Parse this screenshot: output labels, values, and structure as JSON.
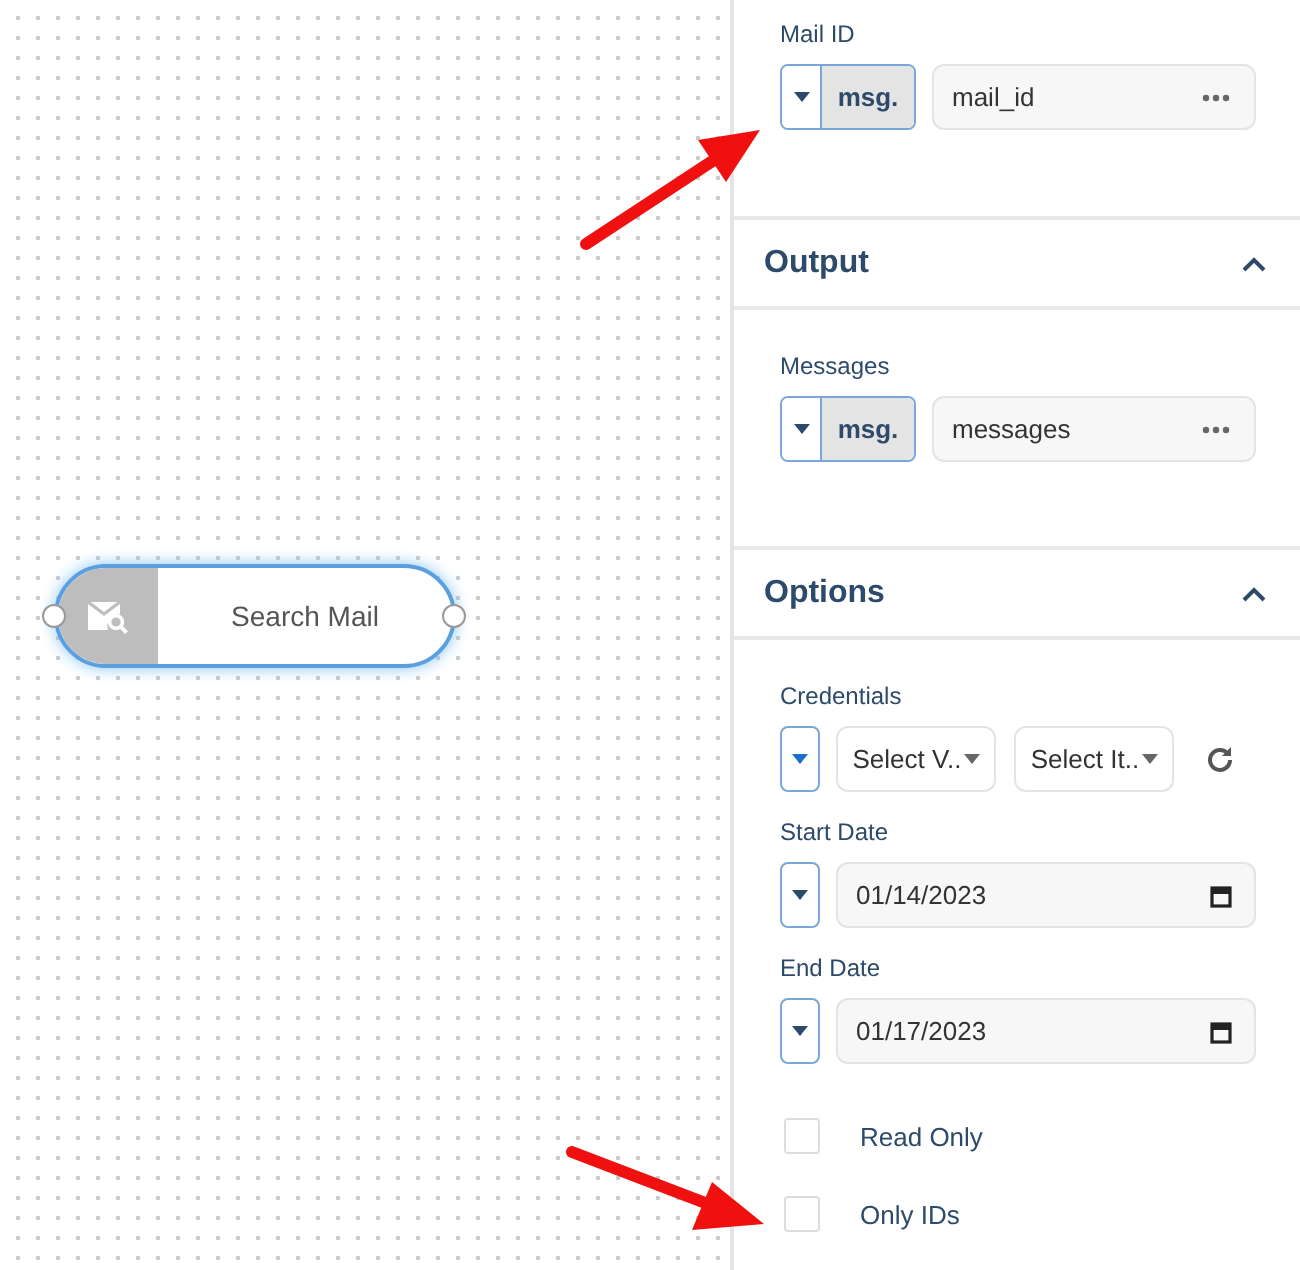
{
  "canvas": {
    "node": {
      "label": "Search Mail",
      "selected": true
    }
  },
  "panel": {
    "fields": [
      {
        "kind": "typed",
        "label": "Mail ID",
        "type": "msg.",
        "value": "mail_id"
      }
    ],
    "sections": [
      {
        "title": "Output",
        "expanded": true,
        "fields": [
          {
            "kind": "typed",
            "label": "Messages",
            "type": "msg.",
            "value": "messages"
          }
        ]
      },
      {
        "title": "Options",
        "expanded": true,
        "fields": [
          {
            "kind": "credentials",
            "label": "Credentials",
            "selects": [
              "Select V..",
              "Select It.."
            ]
          },
          {
            "kind": "date",
            "label": "Start Date",
            "value": "01/14/2023"
          },
          {
            "kind": "date",
            "label": "End Date",
            "value": "01/17/2023"
          },
          {
            "kind": "checkbox",
            "label": "Read Only",
            "checked": false
          },
          {
            "kind": "checkbox",
            "label": "Only IDs",
            "checked": false
          }
        ]
      }
    ]
  }
}
